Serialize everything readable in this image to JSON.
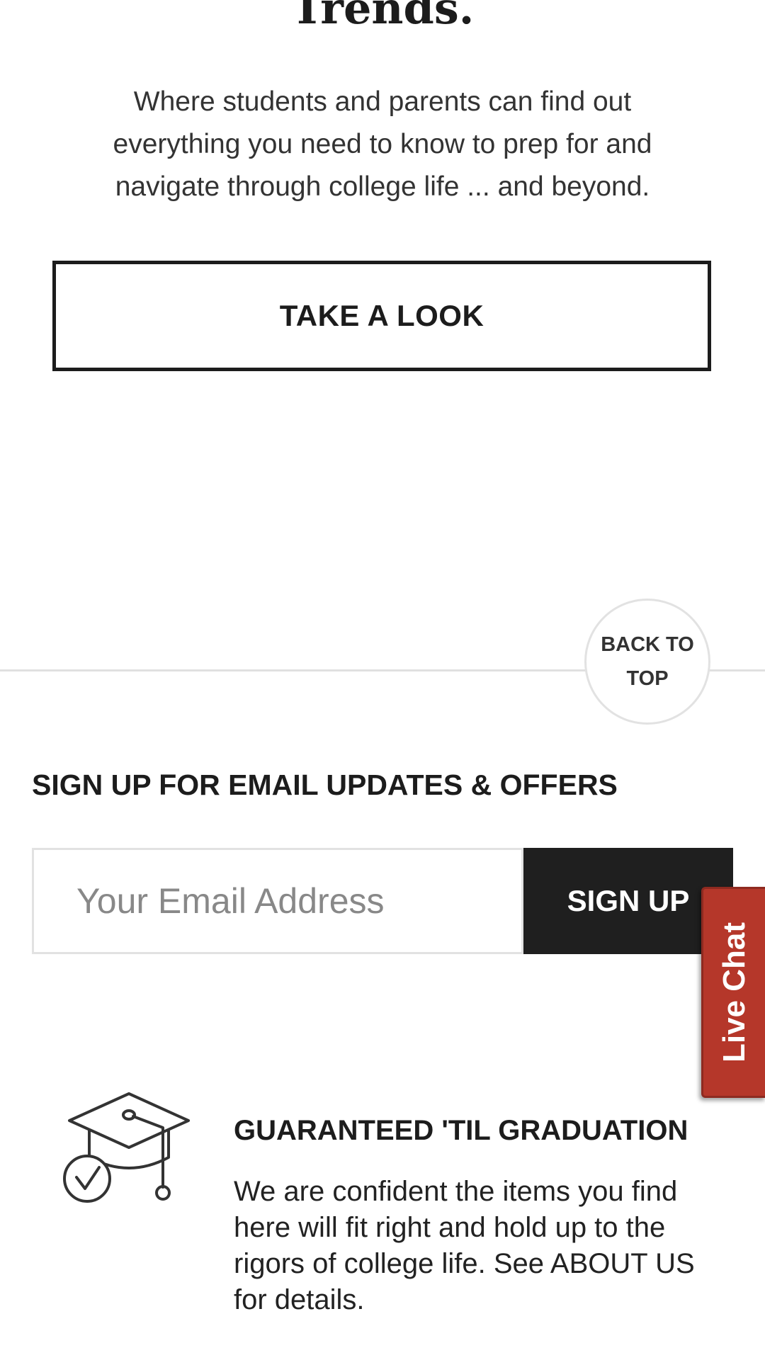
{
  "hero": {
    "title": "Trends.",
    "description": "Where students and parents can find out everything you need to know to prep for and navigate through college life ... and beyond.",
    "cta_label": "TAKE A LOOK"
  },
  "back_to_top": {
    "label": "BACK TO TOP"
  },
  "newsletter": {
    "heading": "SIGN UP FOR EMAIL UPDATES & OFFERS",
    "email_placeholder": "Your Email Address",
    "button_label": "SIGN UP"
  },
  "live_chat": {
    "label": "Live Chat",
    "color": "#b5372a"
  },
  "guarantee": {
    "icon": "graduation-cap-check-icon",
    "heading": "GUARANTEED 'TIL GRADUATION",
    "text": "We are confident the items you find here will fit right and hold up to the rigors of college life. See ABOUT US for details."
  }
}
